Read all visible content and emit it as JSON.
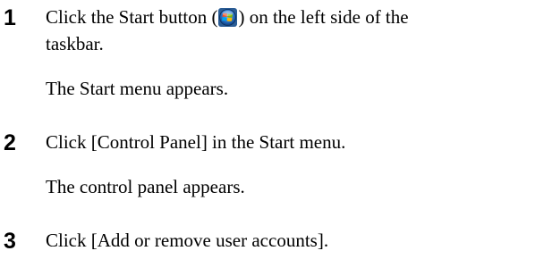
{
  "steps": [
    {
      "number": "1",
      "text_before_icon": "Click the Start button (",
      "text_after_icon": ") on the left side of the",
      "text_line2": "taskbar.",
      "result": "The Start menu appears.",
      "icon": "windows-start-orb-icon"
    },
    {
      "number": "2",
      "text": "Click [Control Panel] in the Start menu.",
      "result": "The control panel appears."
    },
    {
      "number": "3",
      "text": "Click [Add or remove user accounts]."
    }
  ]
}
